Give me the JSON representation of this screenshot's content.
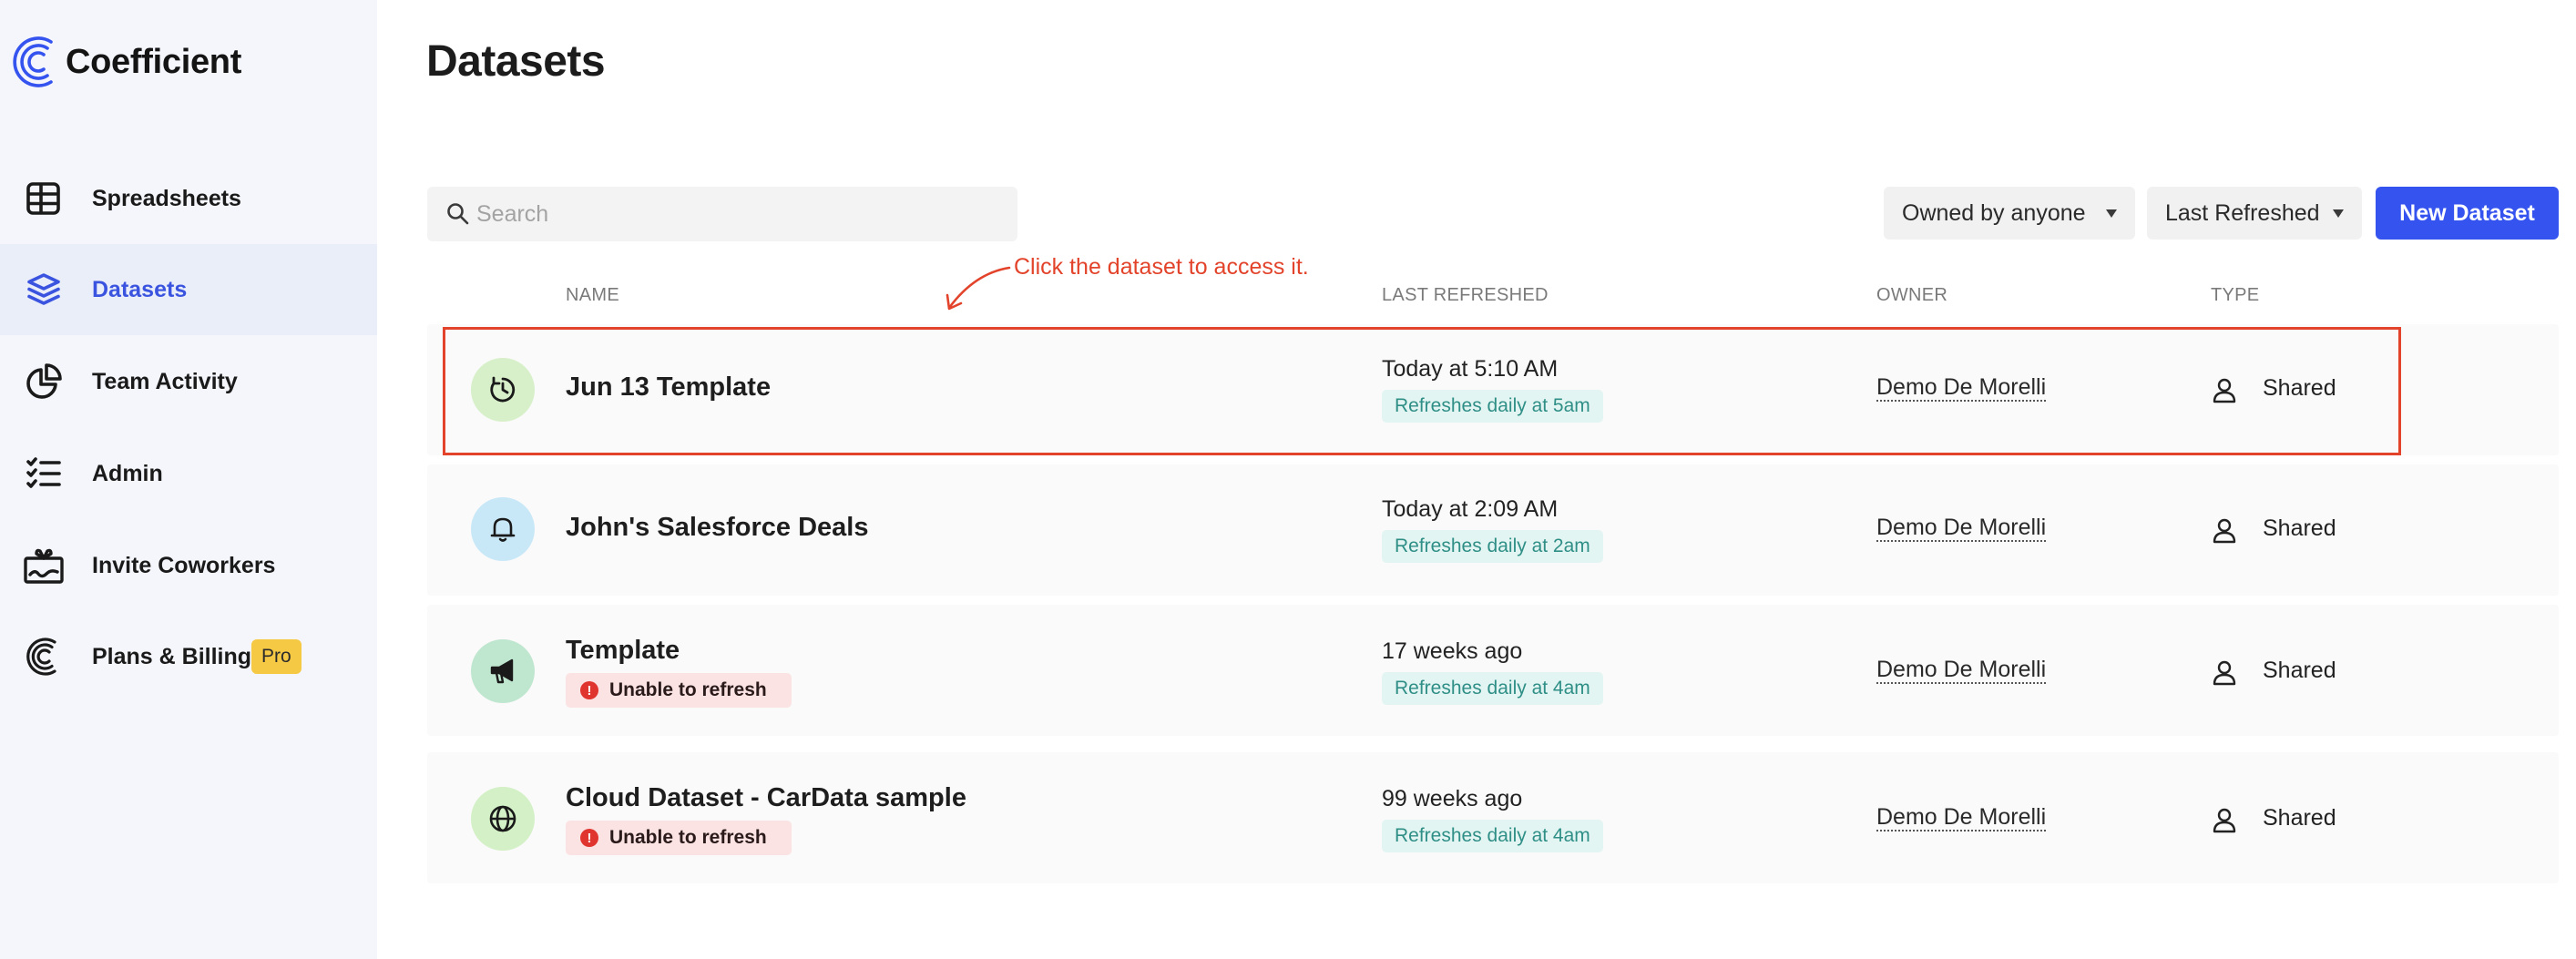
{
  "app": {
    "name": "Coefficient",
    "page_title": "Datasets"
  },
  "sidebar": {
    "items": [
      {
        "label": "Spreadsheets",
        "icon": "table-icon"
      },
      {
        "label": "Datasets",
        "icon": "layers-icon",
        "active": true
      },
      {
        "label": "Team Activity",
        "icon": "pie-chart-icon"
      },
      {
        "label": "Admin",
        "icon": "checklist-icon"
      },
      {
        "label": "Invite Coworkers",
        "icon": "gift-icon"
      },
      {
        "label": "Plans & Billing",
        "icon": "coefficient-logo-icon",
        "badge": "Pro"
      }
    ]
  },
  "toolbar": {
    "search_placeholder": "Search",
    "owner_filter": "Owned by anyone",
    "sort": "Last Refreshed",
    "new_button": "New Dataset"
  },
  "annotation": "Click the dataset to access it.",
  "table": {
    "columns": [
      "NAME",
      "LAST REFRESHED",
      "OWNER",
      "TYPE"
    ],
    "rows": [
      {
        "name": "Jun 13 Template",
        "icon": "clock-refresh-icon",
        "icon_bg": "#d7f0c9",
        "last_refreshed": "Today at 5:10 AM",
        "schedule": "Refreshes daily at 5am",
        "owner": "Demo De Morelli",
        "type": "Shared",
        "error": ""
      },
      {
        "name": "John's Salesforce Deals",
        "icon": "bell-icon",
        "icon_bg": "#c9e8f7",
        "last_refreshed": "Today at 2:09 AM",
        "schedule": "Refreshes daily at 2am",
        "owner": "Demo De Morelli",
        "type": "Shared",
        "error": ""
      },
      {
        "name": "Template",
        "icon": "megaphone-icon",
        "icon_bg": "#bfe6cf",
        "last_refreshed": "17 weeks ago",
        "schedule": "Refreshes daily at 4am",
        "owner": "Demo De Morelli",
        "type": "Shared",
        "error": "Unable to refresh"
      },
      {
        "name": "Cloud Dataset - CarData sample",
        "icon": "globe-icon",
        "icon_bg": "#d4f0c6",
        "last_refreshed": "99 weeks ago",
        "schedule": "Refreshes daily at 4am",
        "owner": "Demo De Morelli",
        "type": "Shared",
        "error": "Unable to refresh"
      }
    ]
  },
  "colors": {
    "accent": "#3553ef",
    "annotation": "#e2432a",
    "error": "#e0342f",
    "schedule_text": "#2f8f87"
  }
}
